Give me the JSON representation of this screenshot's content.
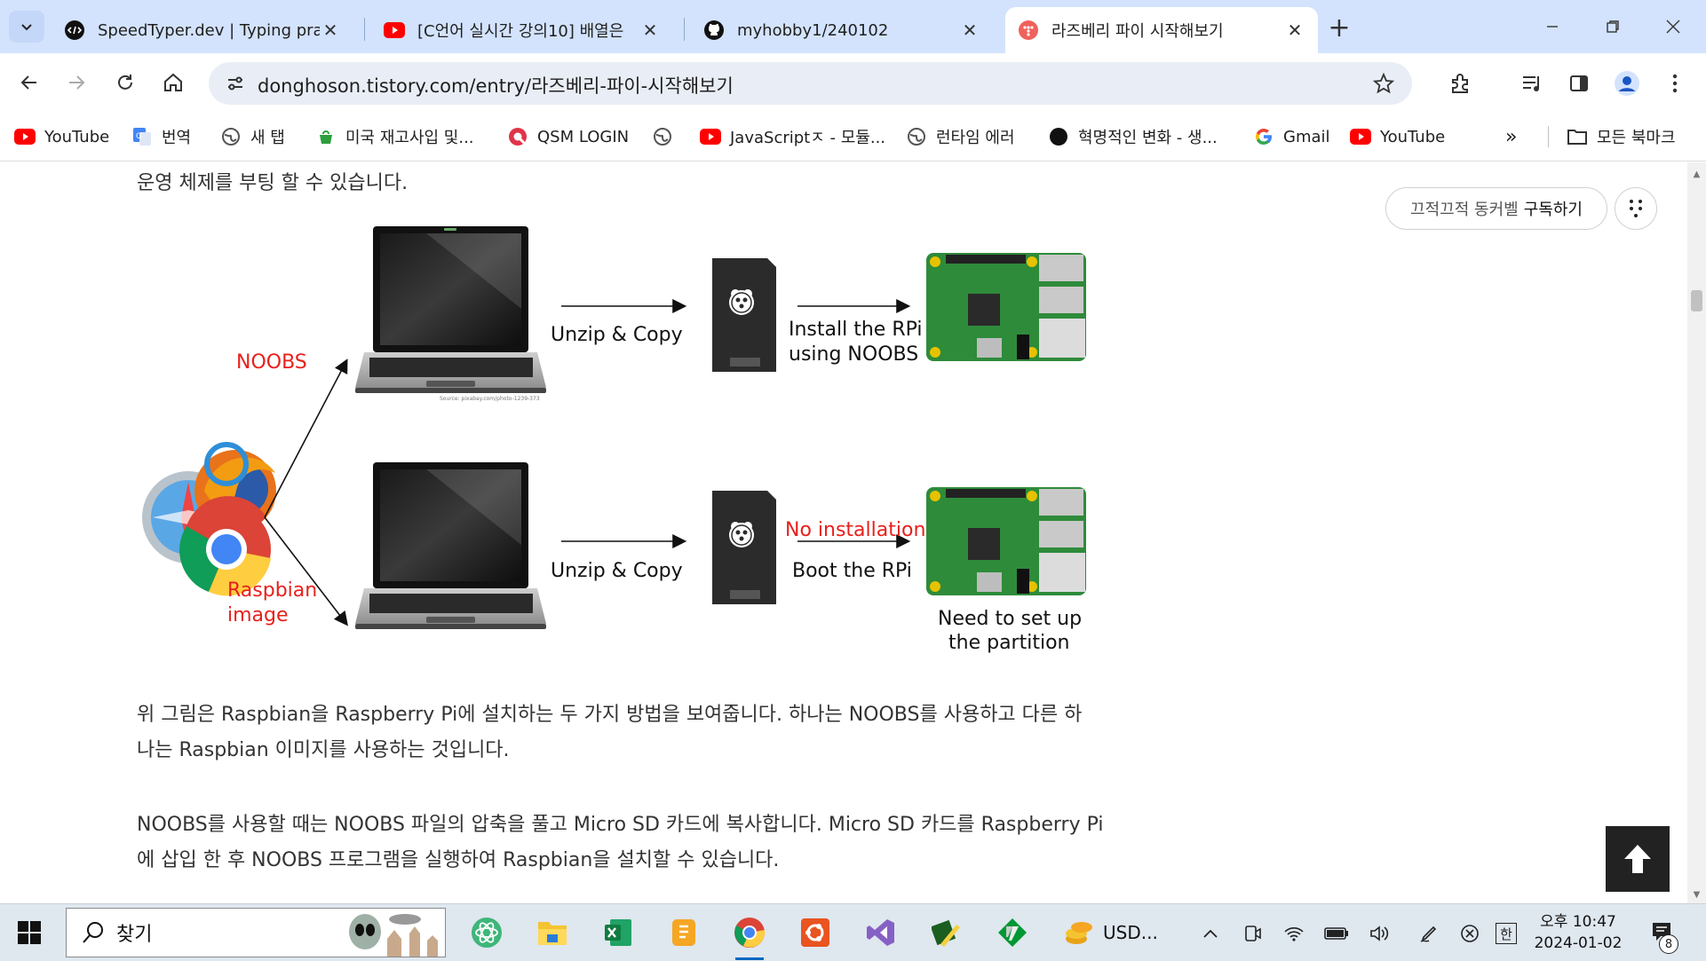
{
  "browser": {
    "tabs": [
      {
        "title": "SpeedTyper.dev | Typing practi",
        "icon": "speedtyper-icon",
        "active": false
      },
      {
        "title": "[C언어 실시간 강의10] 배열은",
        "icon": "youtube-icon",
        "active": false
      },
      {
        "title": "myhobby1/240102",
        "icon": "github-icon",
        "active": false
      },
      {
        "title": "라즈베리 파이 시작해보기",
        "icon": "tistory-icon",
        "active": true
      }
    ],
    "url": "donghoson.tistory.com/entry/라즈베리-파이-시작해보기",
    "bookmarks": [
      {
        "label": "YouTube",
        "icon": "youtube-icon"
      },
      {
        "label": "번역",
        "icon": "translate-icon"
      },
      {
        "label": "새 탭",
        "icon": "globe-icon"
      },
      {
        "label": "미국 재고사입 및...",
        "icon": "cup-icon"
      },
      {
        "label": "QSM LOGIN",
        "icon": "qsm-icon"
      },
      {
        "label": "",
        "icon": "globe-icon"
      },
      {
        "label": "JavaScriptㅈ - 모듈...",
        "icon": "youtube-icon"
      },
      {
        "label": "런타임 에러",
        "icon": "globe-icon"
      },
      {
        "label": "혁명적인 변화 - 생...",
        "icon": "dot-icon"
      },
      {
        "label": "Gmail",
        "icon": "google-icon"
      },
      {
        "label": "YouTube",
        "icon": "youtube-icon"
      }
    ],
    "all_bookmarks_label": "모든 북마크"
  },
  "page": {
    "para0": "운영 체제를 부팅 할 수 있습니다.",
    "subscribe_name": "끄적끄적 동커벨",
    "subscribe_action": "구독하기",
    "para1_line1": "위 그림은 Raspbian을 Raspberry Pi에 설치하는 두 가지 방법을 보여줍니다. 하나는 NOOBS를 사용하고 다른 하",
    "para1_line2": "나는 Raspbian 이미지를 사용하는 것입니다.",
    "para2_line1": "NOOBS를 사용할 때는 NOOBS 파일의 압축을 풀고 Micro SD 카드에 복사합니다. Micro SD 카드를 Raspberry Pi",
    "para2_line2": "에 삽입 한 후 NOOBS 프로그램을 실행하여 Raspbian을 설치할 수 있습니다."
  },
  "diagram": {
    "noobs": "NOOBS",
    "raspbian_1": "Raspbian",
    "raspbian_2": "image",
    "unzip_copy_top": "Unzip & Copy",
    "unzip_copy_bottom": "Unzip & Copy",
    "install_1": "Install the RPi",
    "install_2": "using NOOBS",
    "no_installation": "No installation",
    "boot": "Boot the RPi",
    "setup_1": "Need to set up",
    "setup_2": "the partition",
    "source": "Source: pixabay.com/photo-1239-373"
  },
  "taskbar": {
    "search_label": "찾기",
    "usd_label": "USD...",
    "time": "오후 10:47",
    "date": "2024-01-02",
    "notification_count": "8",
    "ime": "한"
  }
}
